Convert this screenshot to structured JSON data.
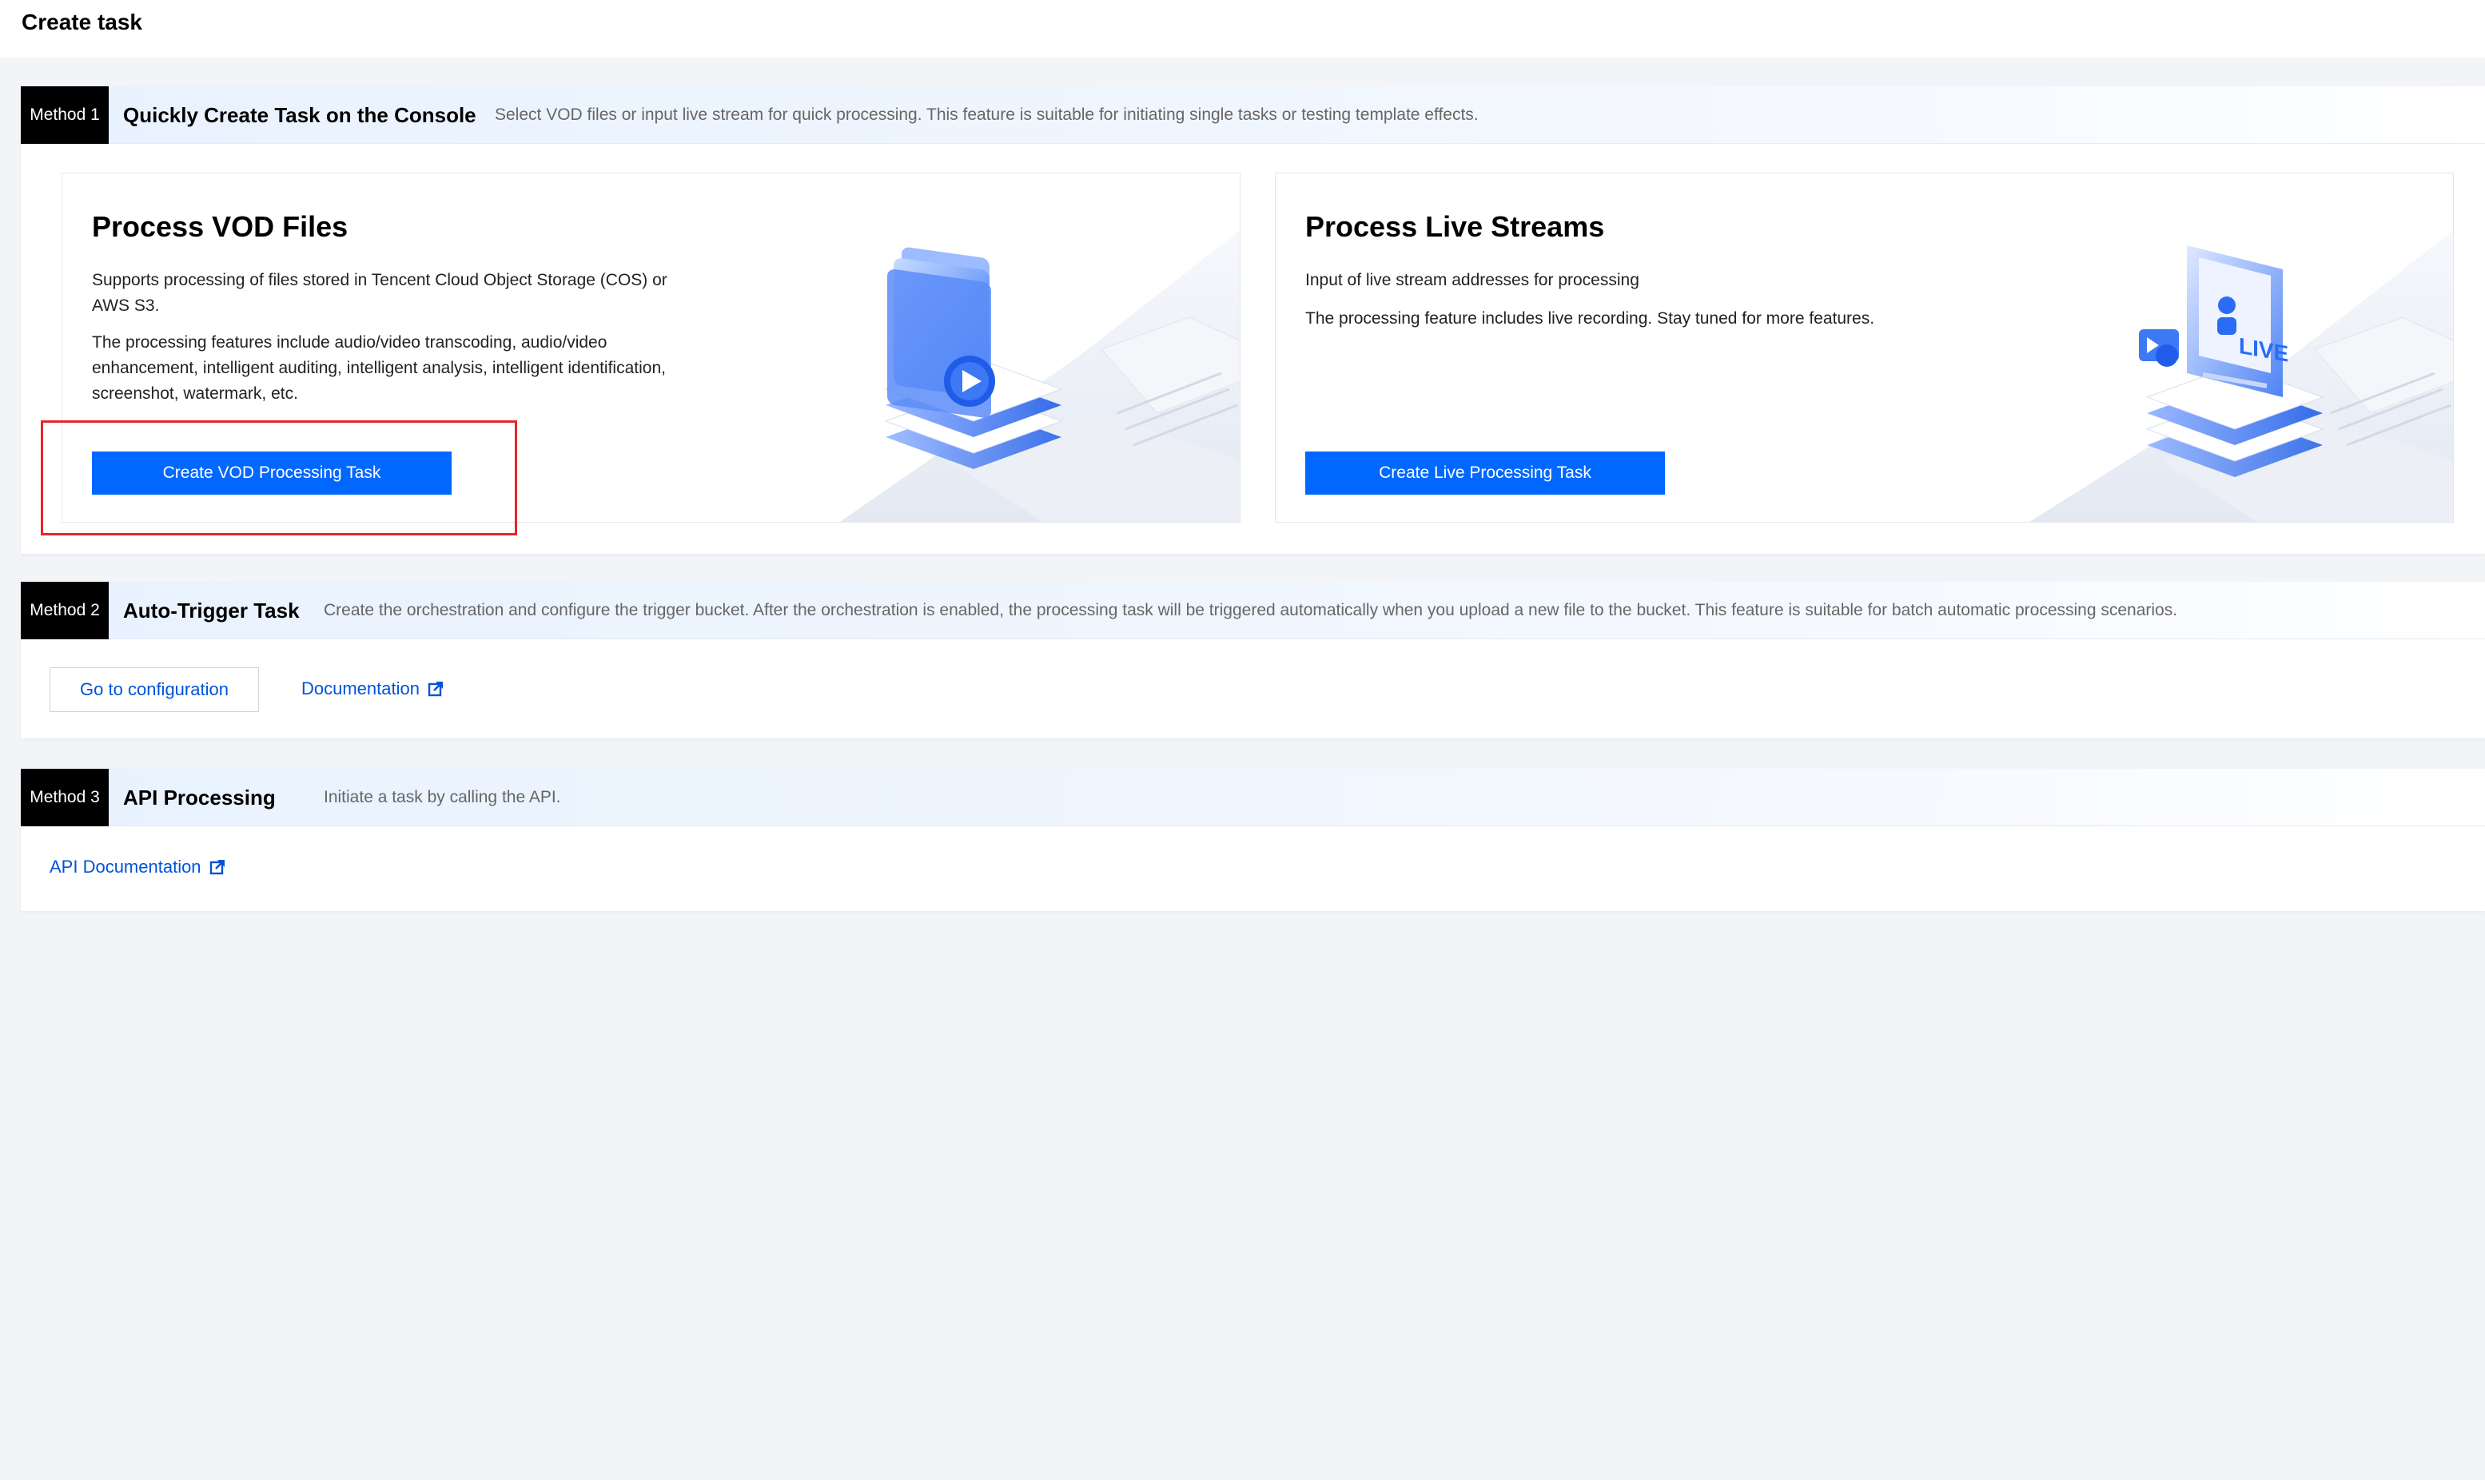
{
  "page": {
    "title": "Create task"
  },
  "method1": {
    "badge": "Method 1",
    "title": "Quickly Create Task on the Console",
    "description": "Select VOD files or input live stream for quick processing. This feature is suitable for initiating single tasks or testing template effects.",
    "vod_card": {
      "title": "Process VOD Files",
      "text1": "Supports processing of files stored in Tencent Cloud Object Storage (COS) or AWS S3.",
      "text2": "The processing features include audio/video transcoding, audio/video enhancement, intelligent auditing, intelligent analysis, intelligent identification, screenshot, watermark, etc.",
      "button": "Create VOD Processing Task",
      "illustration_icon": "folder-play-icon"
    },
    "live_card": {
      "title": "Process Live Streams",
      "text1": "Input of live stream addresses for processing",
      "text2": "The processing feature includes live recording. Stay tuned for more features.",
      "button": "Create Live Processing Task",
      "illustration_icon": "live-screen-icon",
      "illustration_label": "LIVE"
    }
  },
  "method2": {
    "badge": "Method 2",
    "title": "Auto-Trigger Task",
    "description": "Create the orchestration and configure the trigger bucket. After the orchestration is enabled, the processing task will be triggered automatically when you upload a new file to the bucket. This feature is suitable for batch automatic processing scenarios.",
    "config_button": "Go to configuration",
    "doc_link": "Documentation"
  },
  "method3": {
    "badge": "Method 3",
    "title": "API Processing",
    "description": "Initiate a task by calling the API.",
    "api_doc_link": "API Documentation"
  },
  "colors": {
    "primary": "#0068ff",
    "link": "#0052d9",
    "badge_bg": "#000000",
    "highlight": "#e5262a",
    "page_bg": "#f2f4f8"
  }
}
